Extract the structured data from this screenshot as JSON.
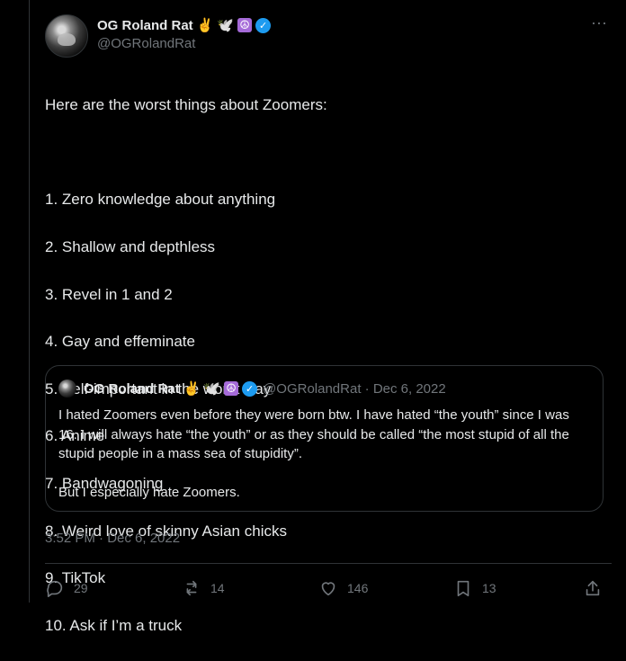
{
  "user": {
    "display_name": "OG Roland Rat",
    "emojis": [
      "✌️",
      "🕊️",
      "☮"
    ],
    "handle": "@OGRolandRat"
  },
  "tweet": {
    "intro": "Here are the worst things about Zoomers:",
    "items": [
      "1. Zero knowledge about anything",
      "2. Shallow and depthless",
      "3. Revel in 1 and 2",
      "4. Gay and effeminate",
      "5. Self-important in the worst way",
      "6. Anime",
      "7. Bandwagoning",
      "8. Weird love of skinny Asian chicks",
      "9. TikTok",
      "10. Ask if I’m a truck"
    ],
    "timestamp": "3:52 PM · Dec 6, 2022"
  },
  "quote": {
    "display_name": "OG Roland Rat",
    "handle_date": "@OGRolandRat · Dec 6, 2022",
    "paragraph_1": "I hated Zoomers even before they were born btw. I have hated “the youth” since I was 16. I will always hate “the youth” or as they should be called “the most stupid of all the stupid people in a mass sea of stupidity”.",
    "paragraph_2": "But I especially hate Zoomers."
  },
  "actions": {
    "replies": "29",
    "reposts": "14",
    "likes": "146",
    "bookmarks": "13"
  },
  "icons": {
    "more": "more-icon",
    "reply": "reply-icon",
    "repost": "repost-icon",
    "like": "heart-icon",
    "bookmark": "bookmark-icon",
    "share": "share-icon",
    "verified": "verified-badge-icon"
  },
  "colors": {
    "background": "#000000",
    "text": "#e7e9ea",
    "muted": "#71767b",
    "border": "#2f3336",
    "verified": "#1d9bf0",
    "peace_badge": "#a56ad8"
  }
}
